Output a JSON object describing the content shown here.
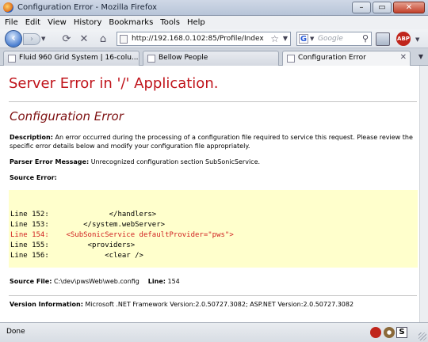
{
  "window": {
    "title": "Configuration Error - Mozilla Firefox"
  },
  "menu": [
    "File",
    "Edit",
    "View",
    "History",
    "Bookmarks",
    "Tools",
    "Help"
  ],
  "toolbar": {
    "url": "http://192.168.0.102:85/Profile/Index",
    "search_placeholder": "Google",
    "abp_label": "ABP"
  },
  "tabs": [
    {
      "label": "Fluid 960 Grid System | 16-colu...",
      "active": false
    },
    {
      "label": "Bellow People",
      "active": false
    },
    {
      "label": "Configuration Error",
      "active": true
    }
  ],
  "page": {
    "heading": "Server Error in '/' Application.",
    "subheading": "Configuration Error",
    "description_label": "Description:",
    "description_text": " An error occurred during the processing of a configuration file required to service this request. Please review the specific error details below and modify your configuration file appropriately.",
    "parser_label": "Parser Error Message:",
    "parser_text": " Unrecognized configuration section SubSonicService.",
    "source_error_label": "Source Error:",
    "code_lines": [
      {
        "text": "Line 152:              </handlers>",
        "error": false
      },
      {
        "text": "Line 153:        </system.webServer>",
        "error": false
      },
      {
        "text": "Line 154:    <SubSonicService defaultProvider=\"pws\">",
        "error": true
      },
      {
        "text": "Line 155:         <providers>",
        "error": false
      },
      {
        "text": "Line 156:             <clear />",
        "error": false
      }
    ],
    "source_file_label": "Source File:",
    "source_file_value": " C:\\dev\\pwsWeb\\web.config ",
    "line_label": "   Line:",
    "line_value": " 154",
    "version_label": "Version Information:",
    "version_text": " Microsoft .NET Framework Version:2.0.50727.3082; ASP.NET Version:2.0.50727.3082"
  },
  "status": {
    "text": "Done"
  }
}
